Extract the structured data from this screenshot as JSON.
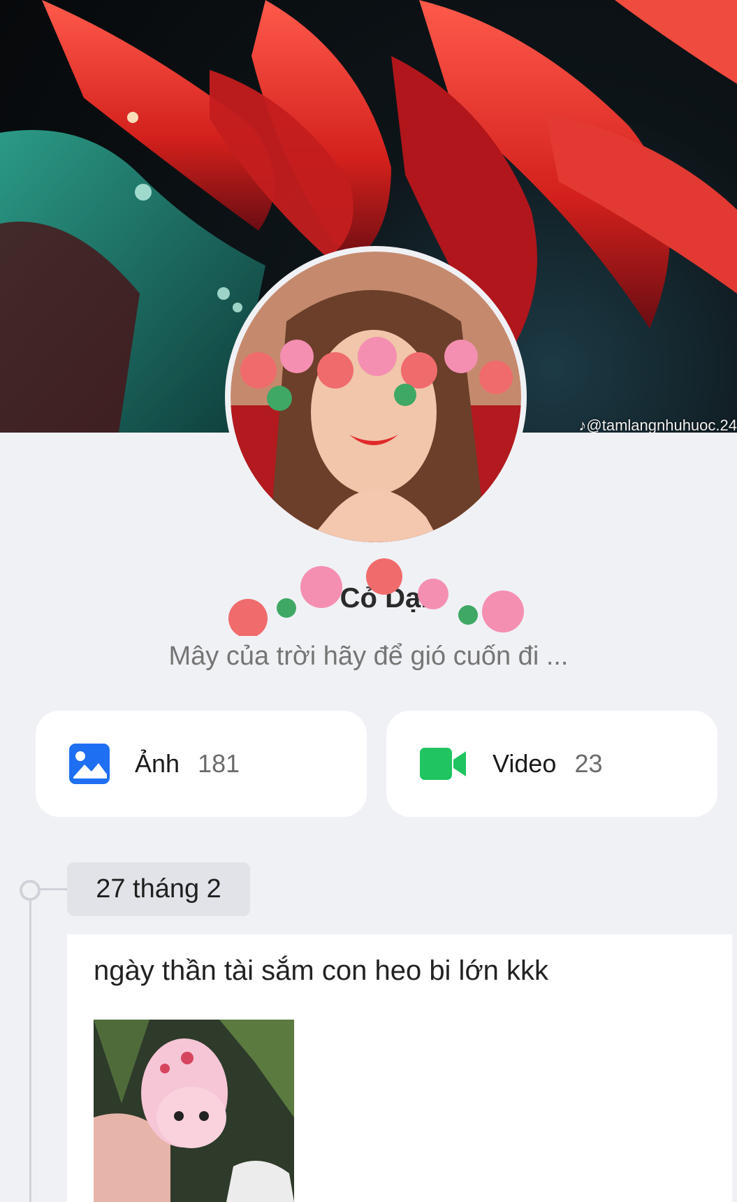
{
  "profile": {
    "watermark": "♪@tamlangnhuhuoc.24",
    "name": "Cỏ Dại",
    "bio": "Mây của trời hãy để gió cuốn đi ..."
  },
  "media": {
    "photos": {
      "label": "Ảnh",
      "count": "181",
      "icon": "photo-icon",
      "color": "#1f6ff2"
    },
    "videos": {
      "label": "Video",
      "count": "23",
      "icon": "video-camera-icon",
      "color": "#20c460"
    }
  },
  "timeline": {
    "date": "27 tháng 2",
    "post": {
      "text": "ngày thần tài sắm con heo bi lớn kkk"
    }
  }
}
